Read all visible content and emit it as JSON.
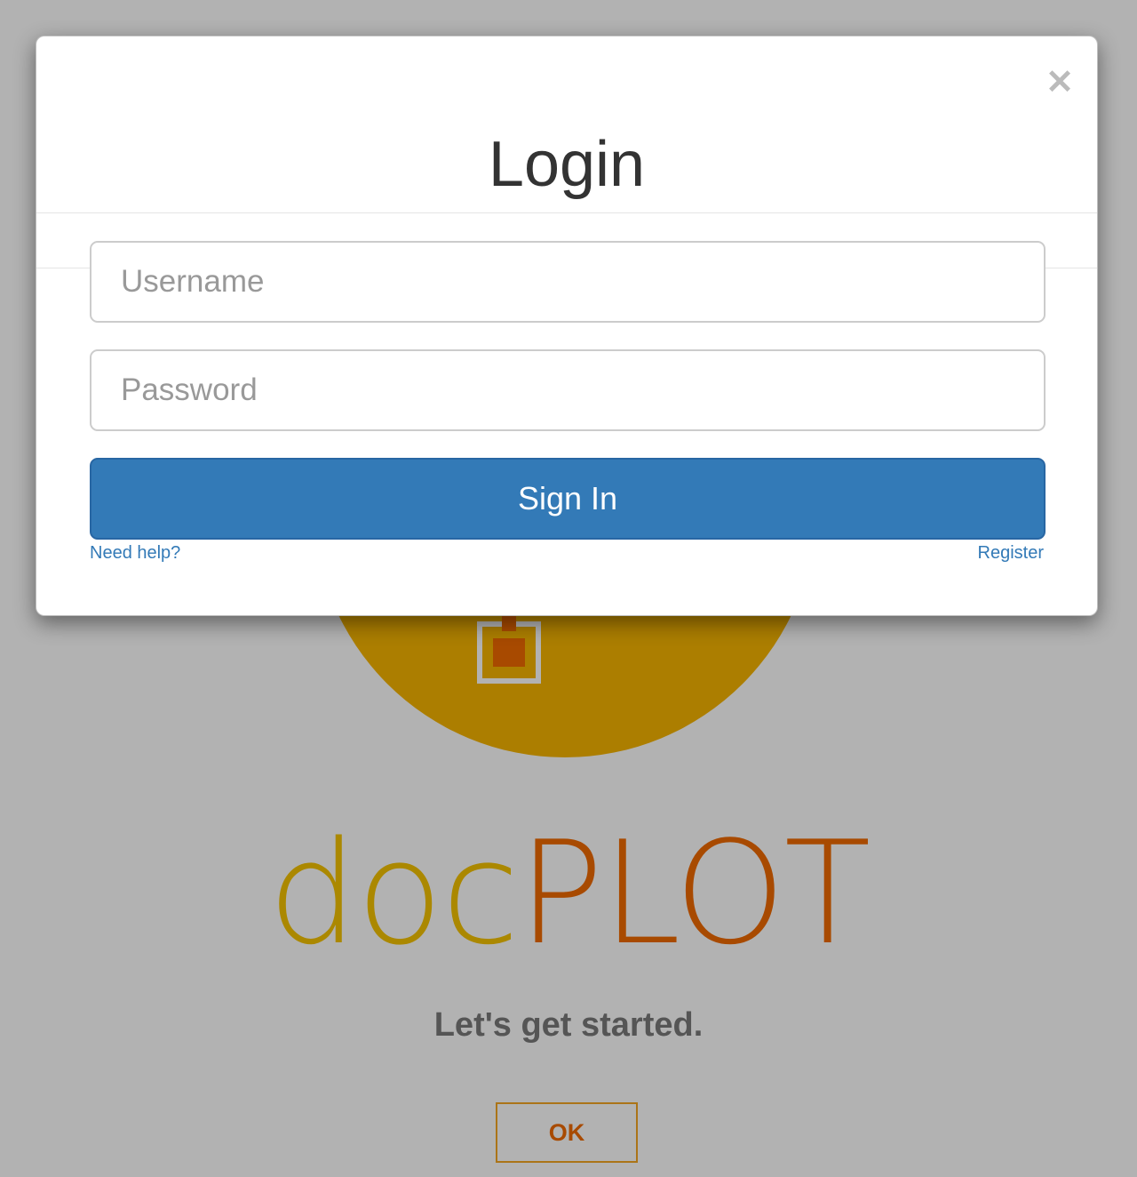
{
  "background": {
    "logo_part1": "doc",
    "logo_part2": "PLOT",
    "tagline": "Let's get started.",
    "ok_label": "OK",
    "colors": {
      "circle": "#f7b500",
      "logo_part1": "#f5c300",
      "logo_part2": "#f16a00",
      "tagline": "#7a7a7a"
    }
  },
  "modal": {
    "title": "Login",
    "close_icon": "close-icon",
    "username": {
      "value": "",
      "placeholder": "Username"
    },
    "password": {
      "value": "",
      "placeholder": "Password"
    },
    "signin_label": "Sign In",
    "help_link": "Need help?",
    "register_link": "Register",
    "colors": {
      "primary": "#337ab7",
      "title": "#333333"
    }
  }
}
